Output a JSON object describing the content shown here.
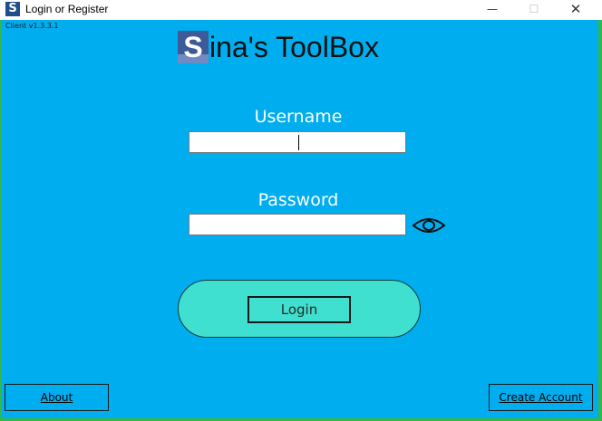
{
  "window": {
    "title": "Login or Register",
    "icon_letter": "S",
    "controls": {
      "minimize": "—",
      "maximize": "☐",
      "close": "✕"
    }
  },
  "version": "Client v1.3.3.1",
  "logo": {
    "letter": "S",
    "text": "ina's ToolBox"
  },
  "form": {
    "username_label": "Username",
    "username_value": "",
    "password_label": "Password",
    "password_value": "",
    "show_password_icon": "eye-icon"
  },
  "buttons": {
    "login": "Login",
    "about": "About",
    "create_account": "Create Account"
  },
  "colors": {
    "background": "#00adef",
    "login_pill": "#3fe0d0",
    "logo": "#3d5a99"
  }
}
